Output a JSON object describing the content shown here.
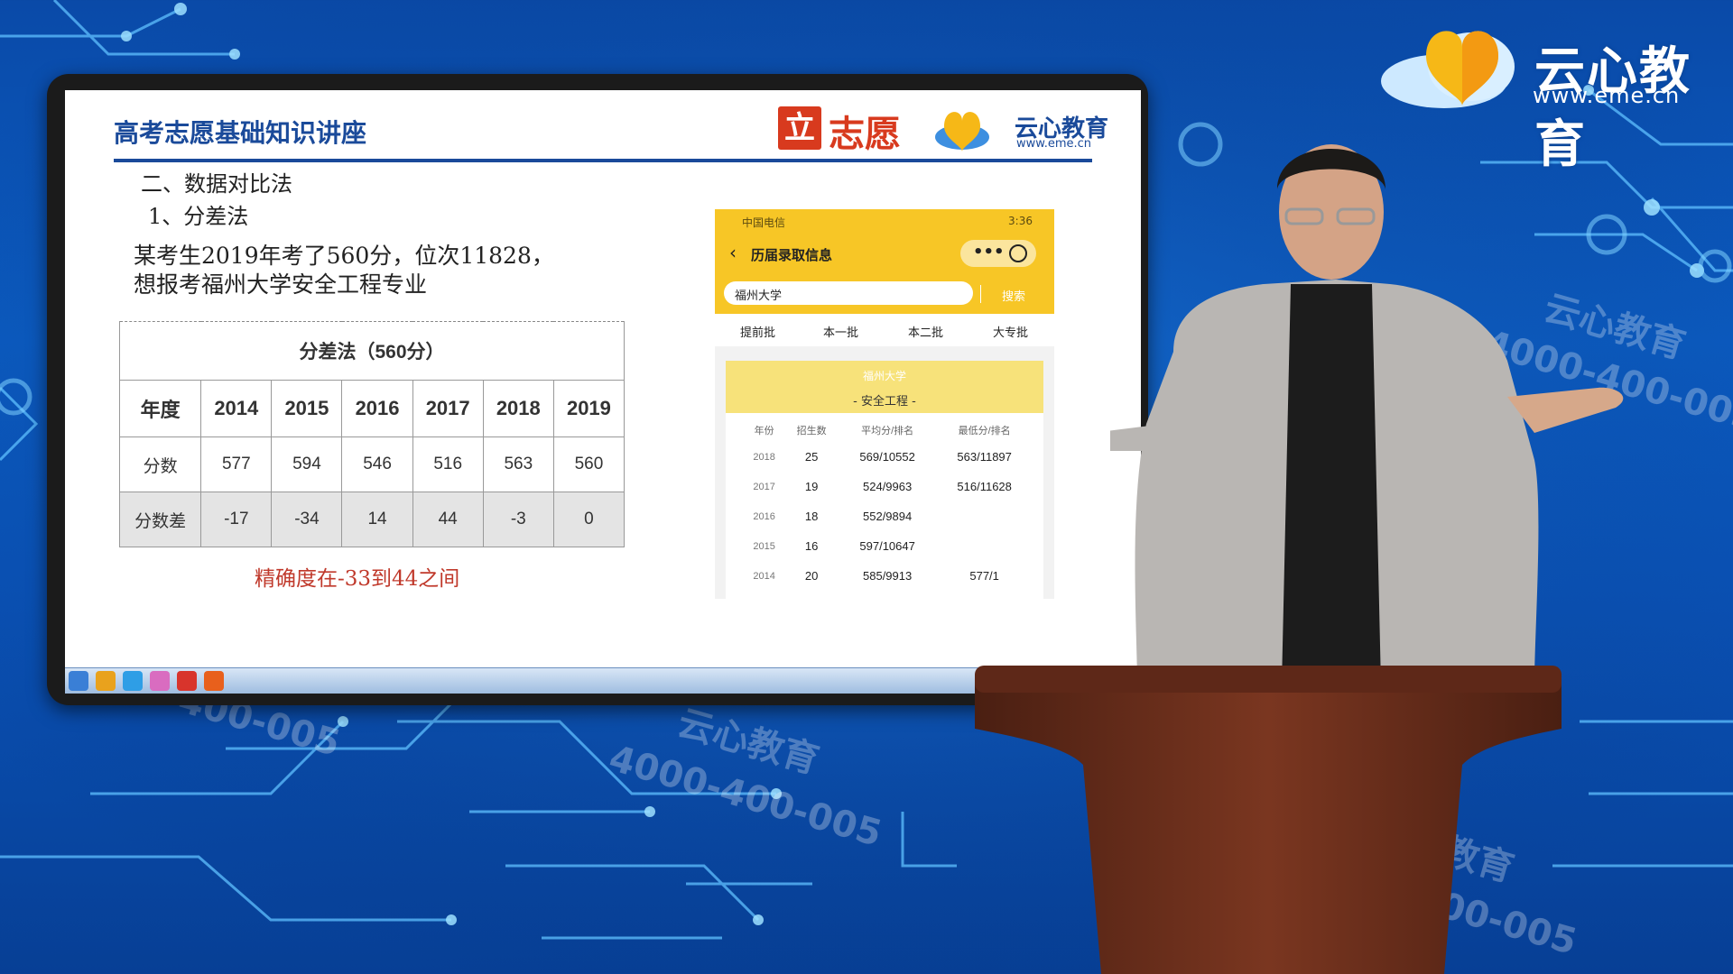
{
  "brand": {
    "name": "云心教育",
    "url": "www.eme.cn"
  },
  "watermarks": {
    "brand": "云心教育",
    "phone": "4000-400-005"
  },
  "slide": {
    "title": "高考志愿基础知识讲座",
    "logo_mark": "立",
    "logo_text": "志愿",
    "logo2_name": "云心教育",
    "logo2_url": "www.eme.cn",
    "section": "二、数据对比法",
    "subsection": "1、分差法",
    "problem_line1": "某考生2019年考了560分，位次11828，",
    "problem_line2": "想报考福州大学安全工程专业",
    "table": {
      "caption": "分差法（560分）",
      "header_label": "年度",
      "years": [
        "2014",
        "2015",
        "2016",
        "2017",
        "2018",
        "2019"
      ],
      "row1_label": "分数",
      "scores": [
        "577",
        "594",
        "546",
        "516",
        "563",
        "560"
      ],
      "row2_label": "分数差",
      "diffs": [
        "-17",
        "-34",
        "14",
        "44",
        "-3",
        "0"
      ]
    },
    "conclusion": "精确度在-33到44之间"
  },
  "phone": {
    "status_left": "中国电信",
    "status_right": "3:36",
    "back_icon": "chevron-left-icon",
    "page_title": "历届录取信息",
    "menu": "•••",
    "search_value": "福州大学",
    "search_button": "搜索",
    "tabs": [
      "提前批",
      "本一批",
      "本二批",
      "大专批"
    ],
    "university": "福州大学",
    "major": "- 安全工程 -",
    "columns": [
      "年份",
      "招生数",
      "平均分/排名",
      "最低分/排名"
    ],
    "rows": [
      [
        "2018",
        "25",
        "569/10552",
        "563/11897"
      ],
      [
        "2017",
        "19",
        "524/9963",
        "516/11628"
      ],
      [
        "2016",
        "18",
        "552/9894",
        ""
      ],
      [
        "2015",
        "16",
        "597/10647",
        ""
      ],
      [
        "2014",
        "20",
        "585/9913",
        "577/1"
      ]
    ]
  }
}
